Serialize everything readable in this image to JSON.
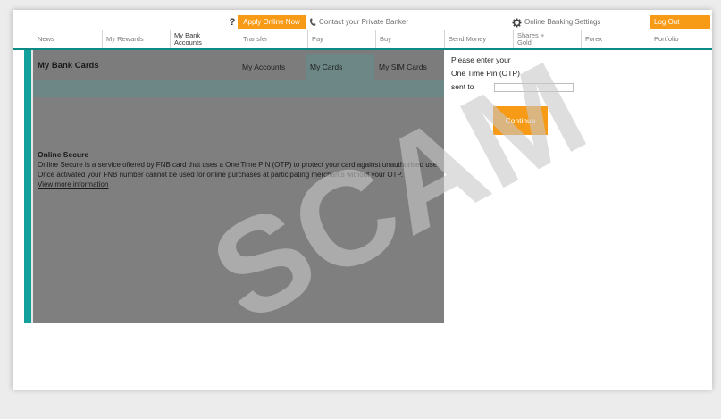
{
  "header": {
    "help_icon": "?",
    "apply_label": "Apply Online Now",
    "contact_label": "Contact your Private Banker",
    "settings_label": "Online Banking Settings",
    "logout_label": "Log Out"
  },
  "nav": {
    "items": [
      {
        "label": "News"
      },
      {
        "label": "My Rewards"
      },
      {
        "label": "My Bank Accounts"
      },
      {
        "label": "Transfer"
      },
      {
        "label": "Pay"
      },
      {
        "label": "Buy"
      },
      {
        "label": "Send Money"
      },
      {
        "label": "Shares + Gold"
      },
      {
        "label": "Forex"
      },
      {
        "label": "Portfolio"
      }
    ]
  },
  "panel": {
    "title": "My Bank Cards",
    "tabs": [
      {
        "label": "My Accounts"
      },
      {
        "label": "My Cards"
      },
      {
        "label": "My SIM Cards"
      }
    ],
    "secure_title": "Online Secure",
    "secure_line1": "Online Secure is a service offered by FNB card that uses a One Time PIN (OTP) to protect your card against unauthorised use.",
    "secure_line2": "Once activated your FNB number cannot be used for online purchases at participating merchants without your OTP.",
    "secure_link": "View more information"
  },
  "otp": {
    "line1": "Please enter your",
    "line2": "One Time Pin (OTP)",
    "line3": "sent to",
    "input_value": "",
    "continue_label": "Continue"
  },
  "watermark": {
    "text": "SCAM"
  },
  "colors": {
    "accent_orange": "#f79a16",
    "teal": "#12a19c",
    "overlay_grey": "#7f7f7f",
    "watermark": "#c8c8c8"
  },
  "icons": {
    "help": "help-icon",
    "phone": "phone-icon",
    "gear": "gear-icon"
  }
}
